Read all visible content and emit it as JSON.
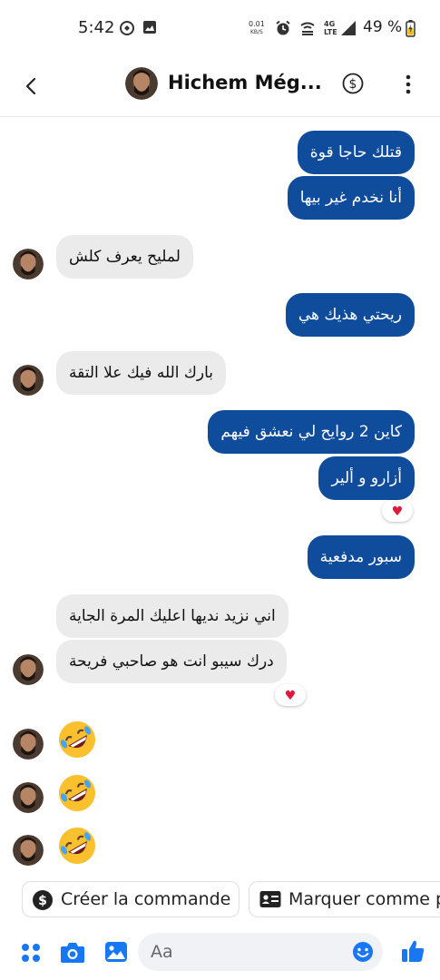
{
  "status_bar": {
    "time": "5:42",
    "net_speed": "0.01",
    "net_unit": "KB/S",
    "network_type": "4G",
    "lte": "LTE",
    "battery": "49 %"
  },
  "header": {
    "contact_name": "Hichem Még..."
  },
  "messages": [
    {
      "direction": "outgoing",
      "text": "قتلك حاجا قوة"
    },
    {
      "direction": "outgoing",
      "text": "أنا نخدم غير بيها"
    },
    {
      "direction": "incoming",
      "text": "لمليح يعرف كلش"
    },
    {
      "direction": "outgoing",
      "text": "ريحتي هذيك هي"
    },
    {
      "direction": "incoming",
      "text": "بارك الله فيك علا التقة"
    },
    {
      "direction": "outgoing",
      "text": "كاين 2 روايح لي نعشق فيهم"
    },
    {
      "direction": "outgoing",
      "text": "أزارو و ألير",
      "reaction": "heart"
    },
    {
      "direction": "outgoing",
      "text": "سبور مدفعية"
    },
    {
      "direction": "incoming",
      "text": "اني نزيد نديها اعليك المرة الجاية"
    },
    {
      "direction": "incoming",
      "text": "درك سيبو انت هو صاحبي فريحة",
      "reaction": "heart"
    },
    {
      "direction": "incoming",
      "emoji": "rolling-on-floor-laughing"
    },
    {
      "direction": "incoming",
      "emoji": "rolling-on-floor-laughing"
    },
    {
      "direction": "incoming",
      "emoji": "rolling-on-floor-laughing"
    }
  ],
  "quick_actions": {
    "create_order": "Créer la commande",
    "mark_as": "Marquer comme p"
  },
  "composer": {
    "placeholder": "Aa"
  },
  "colors": {
    "outgoing_bubble": "#0f4c9c",
    "incoming_bubble": "#ebebeb",
    "accent": "#1877f2"
  }
}
